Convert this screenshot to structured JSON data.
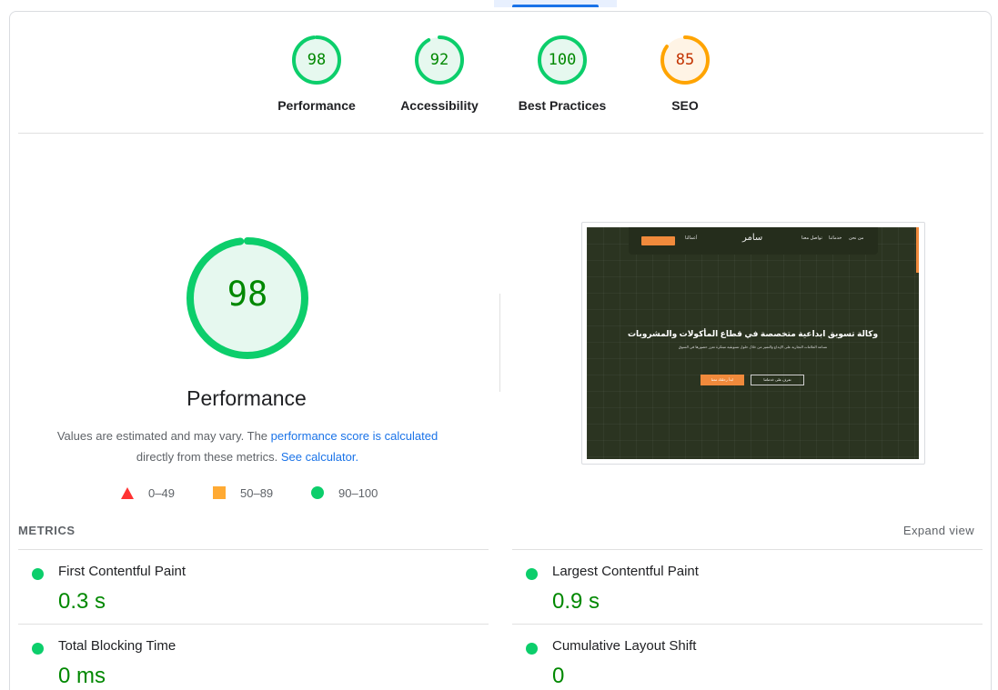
{
  "categories": [
    {
      "label": "Performance",
      "score": 98,
      "rating": "pass",
      "color": "#0cce6b"
    },
    {
      "label": "Accessibility",
      "score": 92,
      "rating": "pass",
      "color": "#0cce6b"
    },
    {
      "label": "Best Practices",
      "score": 100,
      "rating": "pass",
      "color": "#0cce6b"
    },
    {
      "label": "SEO",
      "score": 85,
      "rating": "average",
      "color": "#ffa400"
    }
  ],
  "performance": {
    "score": 98,
    "title": "Performance",
    "desc_prefix": "Values are estimated and may vary. The ",
    "desc_link1": "performance score is calculated",
    "desc_middle": " directly from these metrics. ",
    "desc_link2": "See calculator.",
    "legend": [
      {
        "shape": "triangle",
        "range": "0–49",
        "color": "#ff3333"
      },
      {
        "shape": "square",
        "range": "50–89",
        "color": "#ffaa33"
      },
      {
        "shape": "circle",
        "range": "90–100",
        "color": "#0cce6b"
      }
    ]
  },
  "screenshot": {
    "nav_button": "تواصل معنا",
    "nav_link1": "أعمالنا",
    "nav_link2": "تواصل معنا",
    "nav_link3": "خدماتنا",
    "nav_link4": "من نحن",
    "logo": "سامر",
    "headline": "وكالة تسويق ابداعية متخصصة في قطاع المأكولات والمشروبات",
    "body": "نساعد العلامات التجارية على الإبداع والتميز من خلال حلول تسويقية مبتكرة تعزز حضورها في السوق",
    "cta1": "ابدأ رحلتك معنا",
    "cta2": "تعرف على خدماتنا"
  },
  "metrics": {
    "title": "METRICS",
    "expand": "Expand view",
    "items": [
      {
        "label": "First Contentful Paint",
        "value": "0.3 s"
      },
      {
        "label": "Largest Contentful Paint",
        "value": "0.9 s"
      },
      {
        "label": "Total Blocking Time",
        "value": "0 ms"
      },
      {
        "label": "Cumulative Layout Shift",
        "value": "0"
      }
    ]
  },
  "colors": {
    "pass": "#0cce6b",
    "pass_text": "#008800",
    "average": "#ffa400",
    "average_text": "#c33300",
    "link": "#1a73e8"
  }
}
